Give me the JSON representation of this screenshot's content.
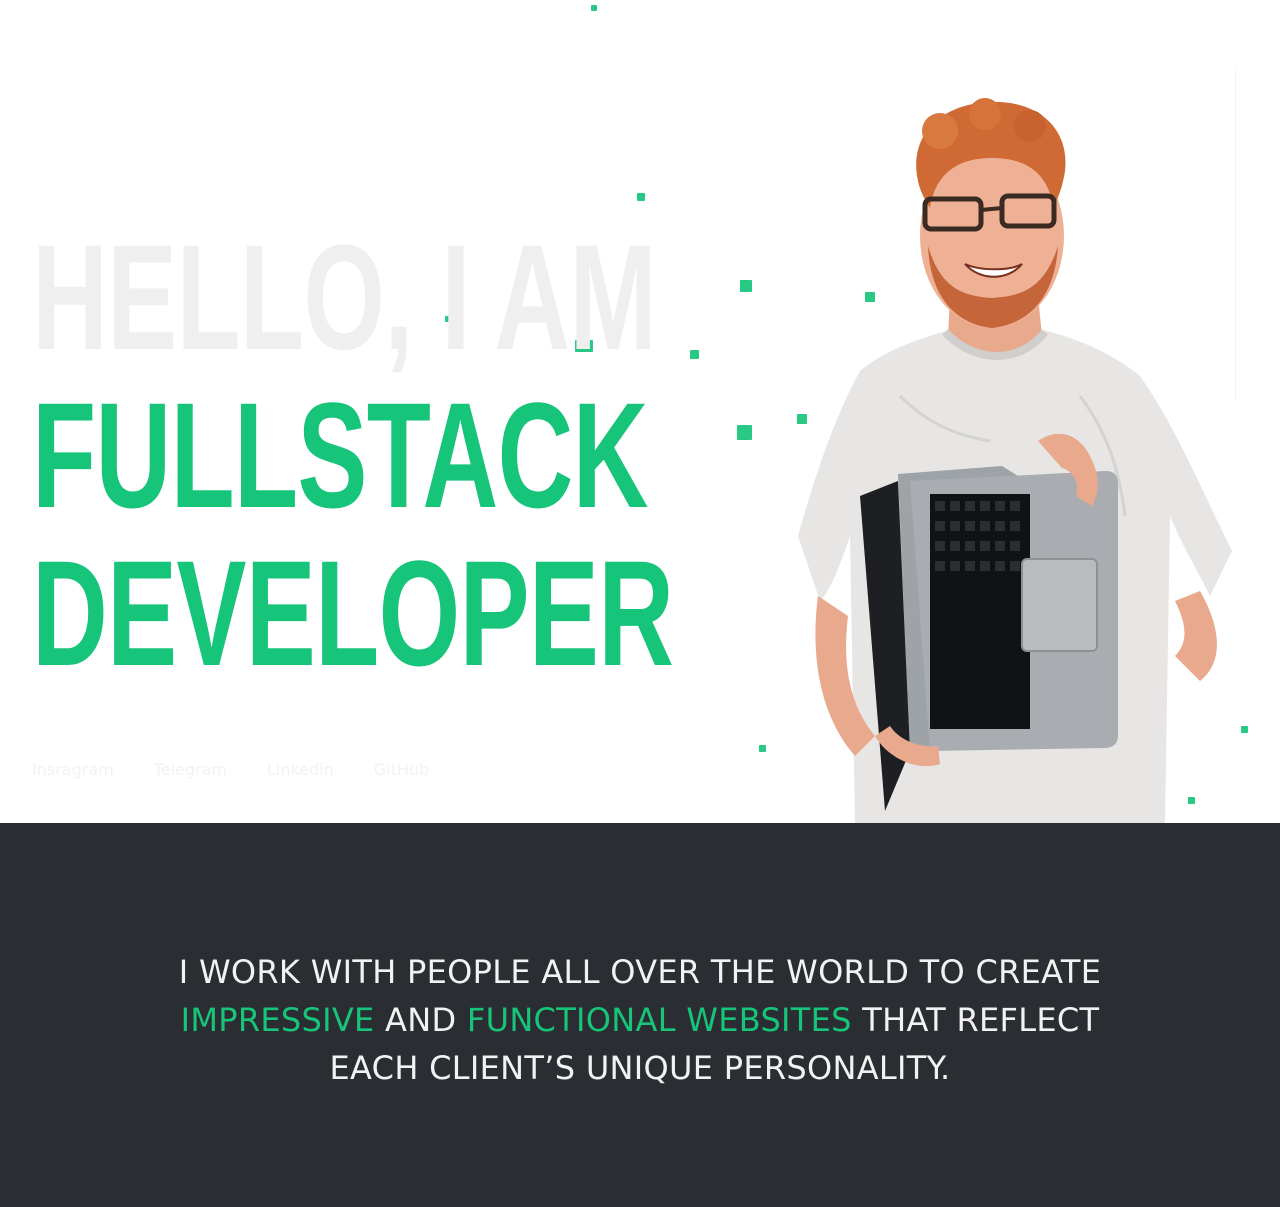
{
  "hero": {
    "headline": {
      "line1": "HELLO, I AM",
      "line2": "FULLSTACK",
      "line3": "DEVELOPER"
    },
    "socials": [
      {
        "label": "Insragram"
      },
      {
        "label": "Telegram"
      },
      {
        "label": "Linkedin"
      },
      {
        "label": "GitHub"
      }
    ]
  },
  "about": {
    "p1": "I work with people all over the world to create",
    "hl1": "impressive",
    "p2": "and",
    "hl2": "functional websites",
    "p3": "that reflect each client’s unique personality."
  },
  "colors": {
    "accent": "#16c47a",
    "greeting": "#efefef",
    "dark_background": "#2a2d31"
  }
}
